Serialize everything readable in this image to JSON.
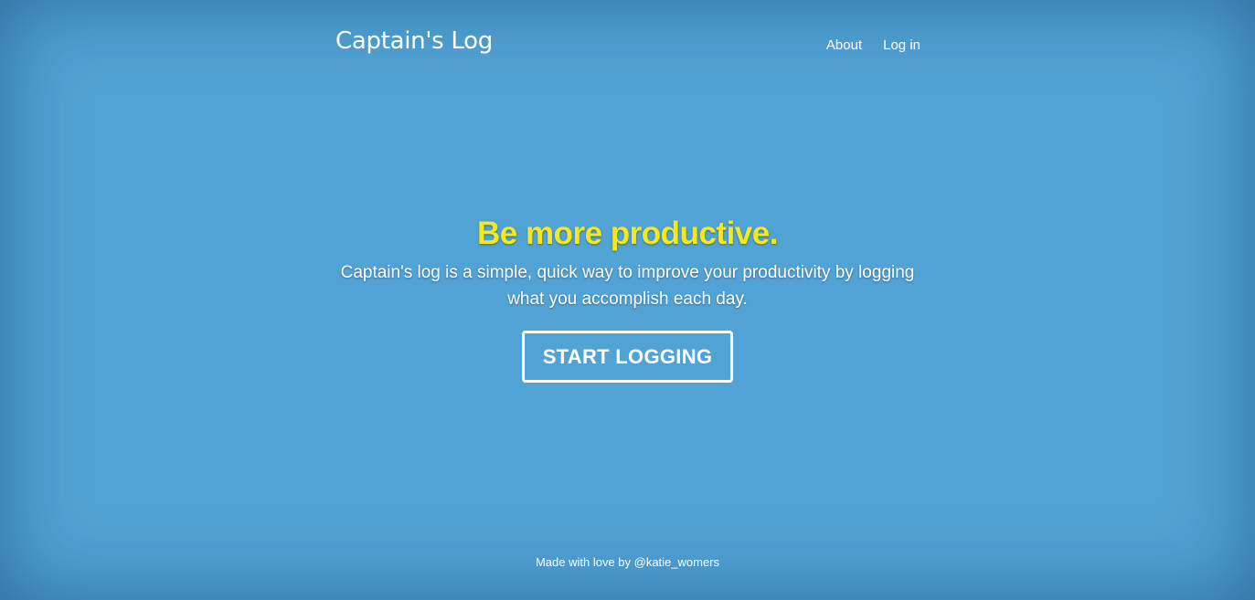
{
  "header": {
    "brand": "Captain's Log",
    "nav": [
      {
        "label": "About"
      },
      {
        "label": "Log in"
      }
    ]
  },
  "hero": {
    "title": "Be more productive.",
    "subtitle": "Captain's log is a simple, quick way to improve your productivity by logging what you accomplish each day.",
    "cta_label": "START LOGGING"
  },
  "footer": {
    "text": "Made with love by @katie_womers"
  },
  "colors": {
    "background": "#52a3d5",
    "headline": "#f5e81b",
    "text": "#ffffff"
  }
}
